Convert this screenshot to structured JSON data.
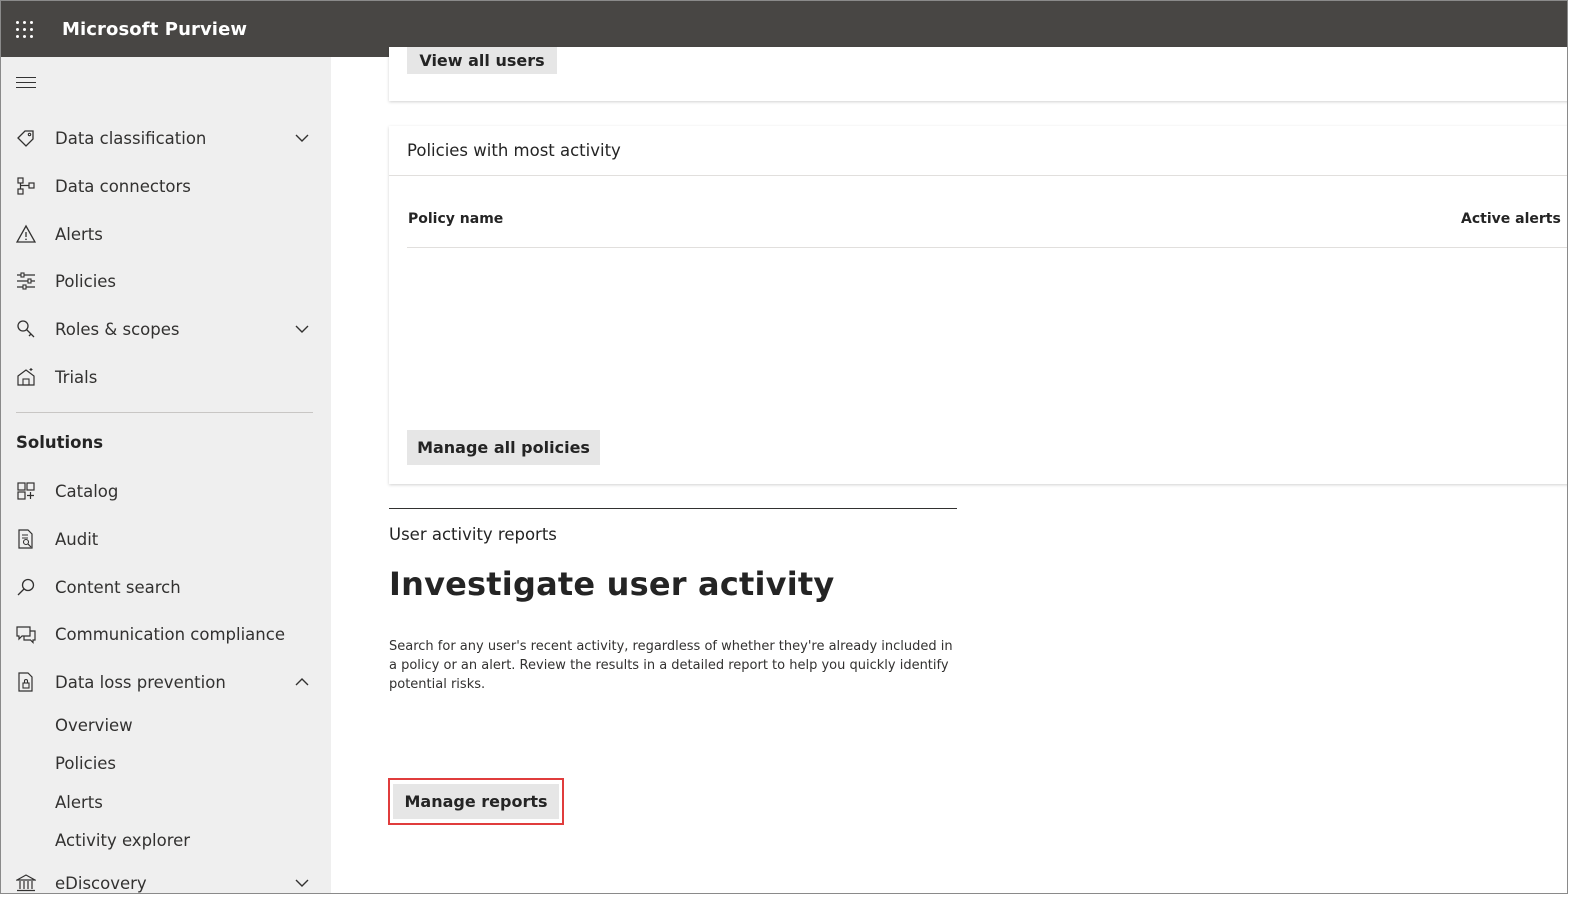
{
  "app": {
    "title": "Microsoft Purview"
  },
  "sidebar": {
    "items": [
      {
        "label": "Data classification",
        "icon": "tag-icon",
        "expandable": true,
        "expanded": false
      },
      {
        "label": "Data connectors",
        "icon": "connector-icon",
        "expandable": false
      },
      {
        "label": "Alerts",
        "icon": "warning-icon",
        "expandable": false
      },
      {
        "label": "Policies",
        "icon": "sliders-icon",
        "expandable": false
      },
      {
        "label": "Roles & scopes",
        "icon": "key-search-icon",
        "expandable": true,
        "expanded": false
      },
      {
        "label": "Trials",
        "icon": "trials-icon",
        "expandable": false
      }
    ],
    "solutions_heading": "Solutions",
    "solutions": [
      {
        "label": "Catalog",
        "icon": "grid-add-icon",
        "expandable": false
      },
      {
        "label": "Audit",
        "icon": "document-search-icon",
        "expandable": false
      },
      {
        "label": "Content search",
        "icon": "search-icon",
        "expandable": false
      },
      {
        "label": "Communication compliance",
        "icon": "chat-icon",
        "expandable": false
      },
      {
        "label": "Data loss prevention",
        "icon": "document-lock-icon",
        "expandable": true,
        "expanded": true
      },
      {
        "label": "eDiscovery",
        "icon": "bank-icon",
        "expandable": true,
        "expanded": false
      }
    ],
    "dlp_subitems": [
      "Overview",
      "Policies",
      "Alerts",
      "Activity explorer"
    ]
  },
  "main": {
    "users_card": {
      "button_label": "View all users"
    },
    "policies_card": {
      "title": "Policies with most activity",
      "columns": [
        "Policy name",
        "Active alerts"
      ],
      "rows": [],
      "button_label": "Manage all policies"
    },
    "user_activity": {
      "label": "User activity reports",
      "heading": "Investigate user activity",
      "description": "Search for any user's recent activity, regardless of whether they're already included in a policy or an alert. Review the results in a detailed report to help you quickly identify potential risks.",
      "button_label": "Manage reports"
    }
  },
  "colors": {
    "topbar": "#484644",
    "sidebar": "#efefef",
    "button": "#e6e6e6",
    "highlight": "#e03c3c"
  }
}
